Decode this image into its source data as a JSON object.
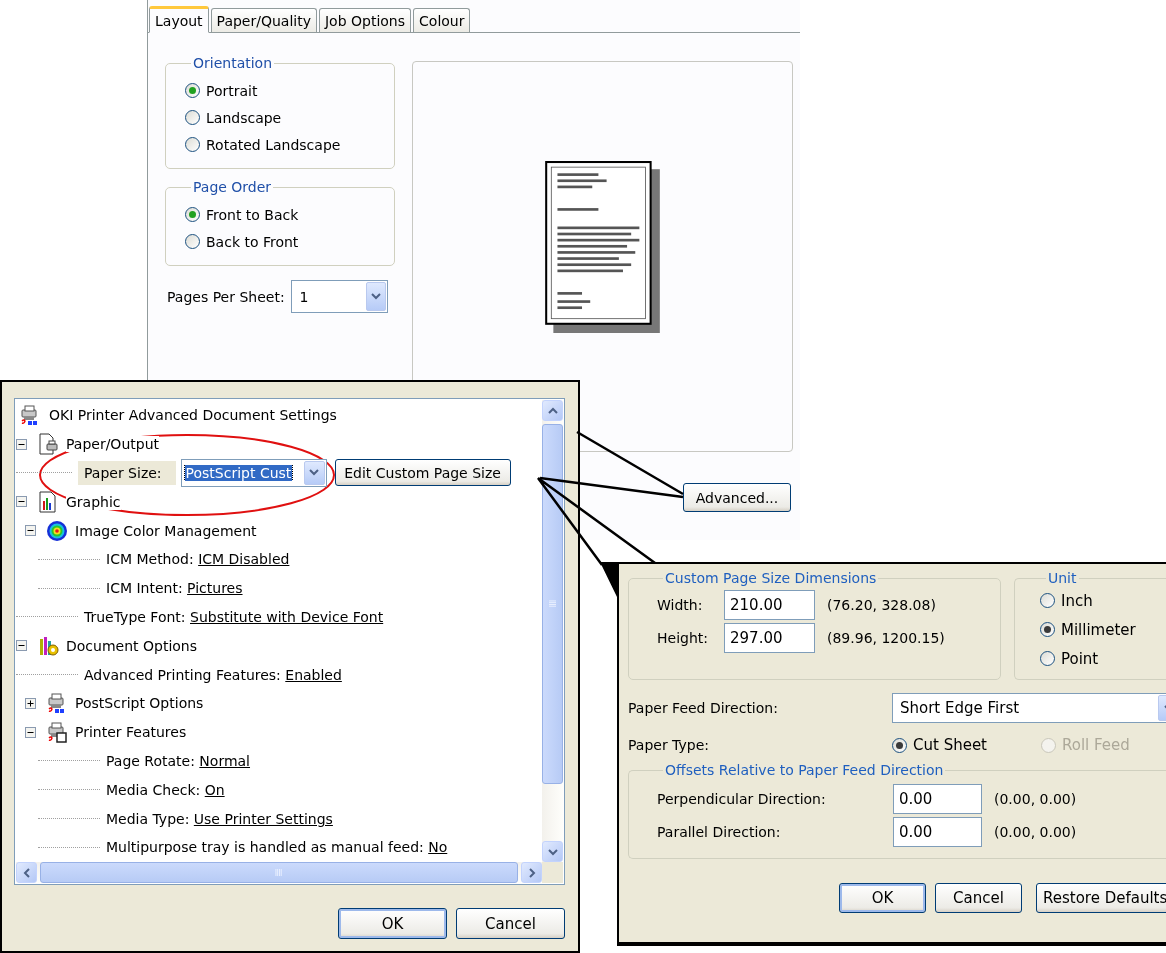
{
  "layout_dialog": {
    "tabs": [
      {
        "label": "Layout",
        "selected": true
      },
      {
        "label": "Paper/Quality",
        "selected": false
      },
      {
        "label": "Job Options",
        "selected": false
      },
      {
        "label": "Colour",
        "selected": false
      }
    ],
    "orientation": {
      "title": "Orientation",
      "options": [
        {
          "label": "Portrait",
          "selected": true
        },
        {
          "label": "Landscape",
          "selected": false
        },
        {
          "label": "Rotated Landscape",
          "selected": false
        }
      ]
    },
    "page_order": {
      "title": "Page Order",
      "options": [
        {
          "label": "Front to Back",
          "selected": true
        },
        {
          "label": "Back to Front",
          "selected": false
        }
      ]
    },
    "pages_per_sheet": {
      "label": "Pages Per Sheet:",
      "value": "1"
    },
    "advanced_button": "Advanced..."
  },
  "advanced_dialog": {
    "tree": {
      "kind": "document",
      "label": "OKI Printer Advanced Document Settings",
      "children": [
        {
          "kind": "paper",
          "label": "Paper/Output",
          "expanded": true,
          "children": [
            {
              "kind": "paper_size",
              "label": "Paper Size:",
              "value": "PostScript Cust",
              "button": "Edit Custom Page Size"
            }
          ]
        },
        {
          "kind": "graphics",
          "label": "Graphic",
          "expanded": true,
          "children": [
            {
              "kind": "color",
              "label": "Image Color Management",
              "expanded": true,
              "children": [
                {
                  "kind": "setting",
                  "label": "ICM Method:",
                  "value": "ICM Disabled"
                },
                {
                  "kind": "setting",
                  "label": "ICM Intent:",
                  "value": "Pictures"
                }
              ]
            },
            {
              "kind": "setting",
              "label": "TrueType Font:",
              "value": "Substitute with Device Font"
            }
          ]
        },
        {
          "kind": "options",
          "label": "Document Options",
          "expanded": true,
          "children": [
            {
              "kind": "setting",
              "label": "Advanced Printing Features:",
              "value": "Enabled"
            },
            {
              "kind": "postscript",
              "label": "PostScript Options",
              "expanded": false
            },
            {
              "kind": "features",
              "label": "Printer Features",
              "expanded": true,
              "children": [
                {
                  "kind": "setting",
                  "label": "Page Rotate:",
                  "value": "Normal"
                },
                {
                  "kind": "setting",
                  "label": "Media Check:",
                  "value": "On"
                },
                {
                  "kind": "setting",
                  "label": "Media Type:",
                  "value": "Use Printer Settings"
                },
                {
                  "kind": "setting",
                  "label": "Multipurpose tray is handled as manual feed:",
                  "value": "No"
                }
              ]
            }
          ]
        }
      ]
    },
    "buttons": [
      "OK",
      "Cancel"
    ]
  },
  "custom_size_dialog": {
    "dimensions": {
      "title": "Custom Page Size Dimensions",
      "fields": [
        {
          "label": "Width:",
          "value": "210.00",
          "range": "(76.20, 328.08)"
        },
        {
          "label": "Height:",
          "value": "297.00",
          "range": "(89.96, 1200.15)"
        }
      ]
    },
    "unit": {
      "title": "Unit",
      "options": [
        {
          "label": "Inch",
          "selected": false
        },
        {
          "label": "Millimeter",
          "selected": true
        },
        {
          "label": "Point",
          "selected": false
        }
      ]
    },
    "feed_direction": {
      "label": "Paper Feed Direction:",
      "value": "Short Edge First"
    },
    "paper_type": {
      "label": "Paper Type:",
      "options": [
        {
          "label": "Cut Sheet",
          "selected": true,
          "disabled": false
        },
        {
          "label": "Roll Feed",
          "selected": false,
          "disabled": true
        }
      ]
    },
    "offsets": {
      "title": "Offsets Relative to Paper Feed Direction",
      "fields": [
        {
          "label": "Perpendicular Direction:",
          "value": "0.00",
          "range": "(0.00, 0.00)"
        },
        {
          "label": "Parallel Direction:",
          "value": "0.00",
          "range": "(0.00, 0.00)"
        }
      ]
    },
    "buttons": [
      "OK",
      "Cancel",
      "Restore Defaults"
    ]
  }
}
